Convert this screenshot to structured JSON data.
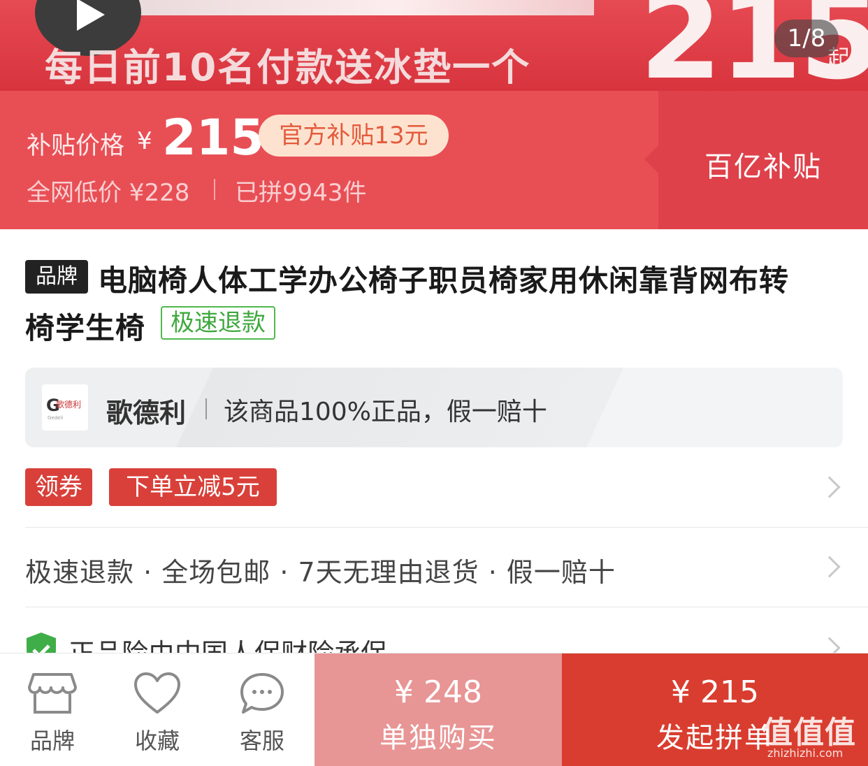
{
  "banner": {
    "slogan": "每日前10名付款送冰垫一个",
    "big_price": "215",
    "big_price_suffix": "起",
    "image_counter": "1/8"
  },
  "subsidy": {
    "label": "补贴价格",
    "currency": "¥",
    "price": "215",
    "official_pill": "官方补贴13元",
    "lowest_price": "全网低价 ¥228",
    "sold_count": "已拼9943件",
    "campaign": "百亿补贴"
  },
  "product": {
    "brand_badge": "品牌",
    "title_line1": "电脑椅人体工学办公椅子职员椅家用休闲靠背网布转",
    "title_line2": "椅学生椅",
    "fast_refund_tag": "极速退款"
  },
  "store": {
    "logo_text": "Gedeli",
    "logo_cn": "歌德利",
    "name": "歌德利",
    "guarantee": "该商品100%正品，假一赔十"
  },
  "coupon": {
    "coupon_label": "领券",
    "discount_label": "下单立减5元"
  },
  "services": {
    "text": "极速退款 · 全场包邮 · 7天无理由退货 · 假一赔十"
  },
  "insurance": {
    "text": "正品险由中国人保财险承保"
  },
  "bottom_bar": {
    "nav": [
      {
        "label": "品牌",
        "icon": "store-icon"
      },
      {
        "label": "收藏",
        "icon": "heart-icon"
      },
      {
        "label": "客服",
        "icon": "chat-icon"
      }
    ],
    "single_buy": {
      "price": "¥ 248",
      "label": "单独购买"
    },
    "group_buy": {
      "price": "¥ 215",
      "label": "发起拼单"
    }
  },
  "watermark": {
    "text": "值值值",
    "url": "zhizhizhi.com"
  },
  "colors": {
    "accent_red": "#e84f55",
    "dark_red": "#d93d2f",
    "single_buy_pink": "#e89595",
    "green_tag": "#4fb84c"
  }
}
